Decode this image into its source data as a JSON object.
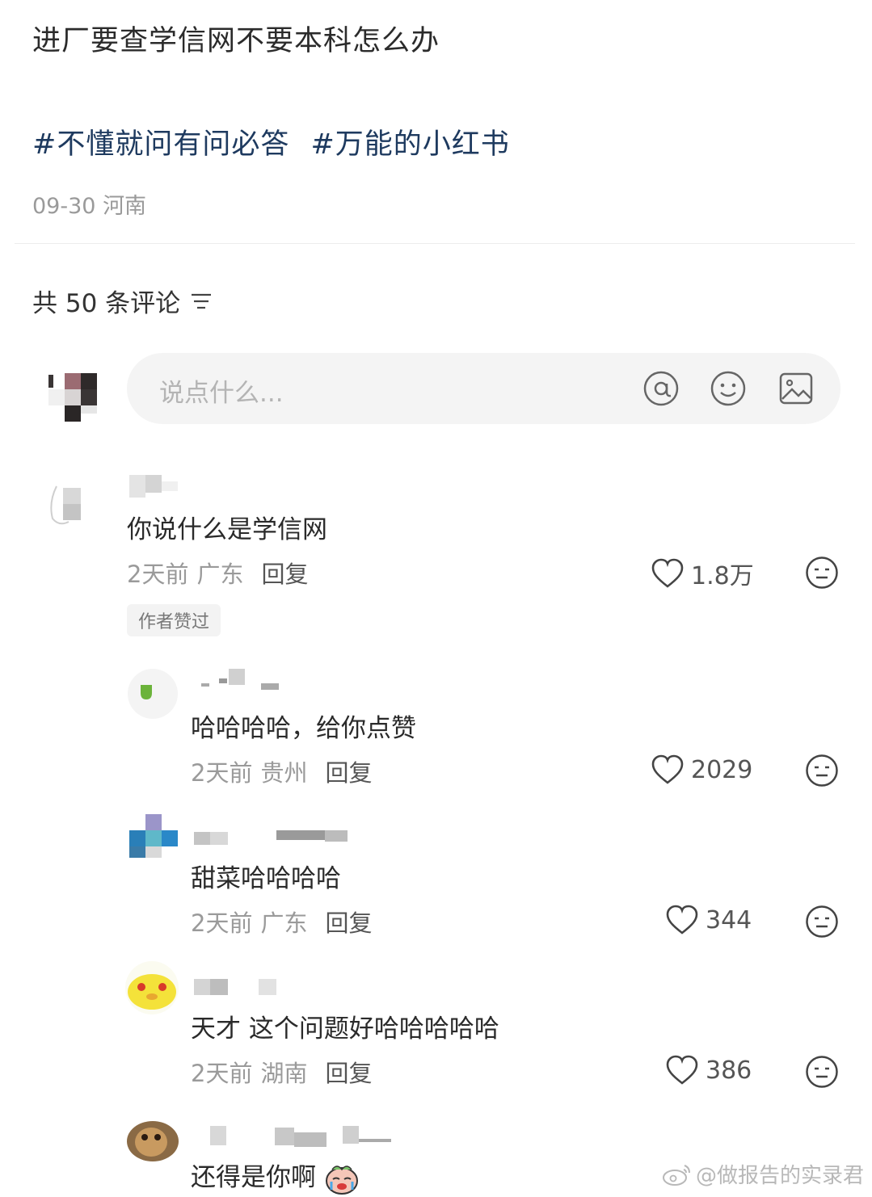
{
  "post": {
    "title": "进厂要查学信网不要本科怎么办",
    "hashtags": [
      "#不懂就问有问必答",
      "#万能的小红书"
    ],
    "date": "09-30",
    "location": "河南"
  },
  "comments_header": {
    "label": "共 50 条评论",
    "sort_icon": "sort-lines-icon"
  },
  "input": {
    "placeholder": "说点什么...",
    "icons": [
      "at-icon",
      "emoji-icon",
      "image-icon"
    ]
  },
  "comments": [
    {
      "text": "你说什么是学信网",
      "time": "2天前",
      "location": "广东",
      "reply_label": "回复",
      "likes": "1.8万",
      "badge": "作者赞过"
    },
    {
      "text": "哈哈哈哈，给你点赞",
      "time": "2天前",
      "location": "贵州",
      "reply_label": "回复",
      "likes": "2029"
    },
    {
      "text": "甜菜哈哈哈哈",
      "time": "2天前",
      "location": "广东",
      "reply_label": "回复",
      "likes": "344"
    },
    {
      "text": "天才  这个问题好哈哈哈哈哈",
      "time": "2天前",
      "location": "湖南",
      "reply_label": "回复",
      "likes": "386"
    },
    {
      "text": "还得是你啊"
    }
  ],
  "watermark": "@做报告的实录君",
  "colors": {
    "hashtag": "#1e3a5f",
    "meta": "#9a9a9a",
    "input_bg": "#f4f4f4"
  }
}
